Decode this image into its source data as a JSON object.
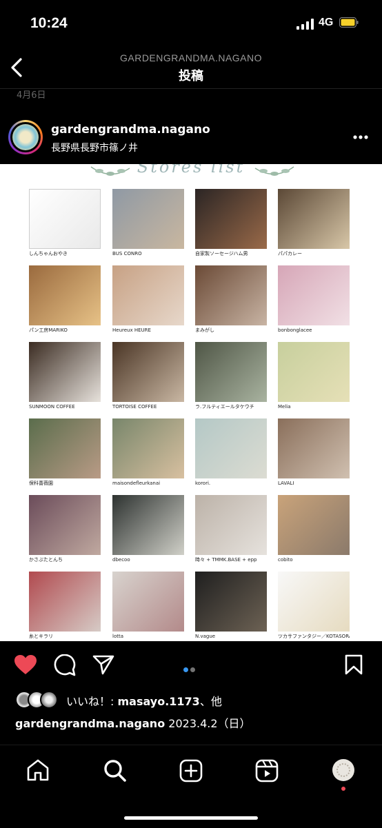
{
  "status_bar": {
    "time": "10:24",
    "network": "4G"
  },
  "nav": {
    "handle": "GARDENGRANDMA.NAGANO",
    "title": "投稿"
  },
  "post_date": "4月6日",
  "author": {
    "username": "gardengrandma.nagano",
    "location": "長野県長野市篠ノ井"
  },
  "post_image": {
    "header_title": "Stores list",
    "stores": [
      {
        "name": "しんちゃんおやき",
        "colors": [
          "#ffffff",
          "#e9e9e9"
        ]
      },
      {
        "name": "BUS CONRO",
        "colors": [
          "#8f99a4",
          "#c9b7a0"
        ]
      },
      {
        "name": "自家製ソーセージハム男",
        "colors": [
          "#2b2524",
          "#9a6a49"
        ]
      },
      {
        "name": "パパカレー",
        "colors": [
          "#5b4836",
          "#d8c7a8"
        ]
      },
      {
        "name": "パン工房MARIKO",
        "colors": [
          "#9a6a3e",
          "#e7c287"
        ]
      },
      {
        "name": "Heureux HEURE",
        "colors": [
          "#c7a184",
          "#e7d8cb"
        ]
      },
      {
        "name": "まみがし",
        "colors": [
          "#6b4a36",
          "#c8b4a4"
        ]
      },
      {
        "name": "bonbonglacee",
        "colors": [
          "#d6a6b7",
          "#f1e0e5"
        ]
      },
      {
        "name": "SUNMOON COFFEE",
        "colors": [
          "#3b2c22",
          "#e7e2dc"
        ]
      },
      {
        "name": "TORTOISE COFFEE",
        "colors": [
          "#4a3525",
          "#c9b7a3"
        ]
      },
      {
        "name": "ラ.フルティエールタケウチ",
        "colors": [
          "#4f5646",
          "#a9b3a0"
        ]
      },
      {
        "name": "Melia",
        "colors": [
          "#c7cf9d",
          "#e6e0b7"
        ]
      },
      {
        "name": "保科薔薇園",
        "colors": [
          "#5a6d4c",
          "#b99b86"
        ]
      },
      {
        "name": "maisondefleurkanai",
        "colors": [
          "#78866b",
          "#d8c0a0"
        ]
      },
      {
        "name": "korori.",
        "colors": [
          "#b4c8c6",
          "#dcdcd2"
        ]
      },
      {
        "name": "LAVALI",
        "colors": [
          "#8a6f5b",
          "#d0c0b0"
        ]
      },
      {
        "name": "かさぶたとんち",
        "colors": [
          "#6b4c5a",
          "#c0a9a0"
        ]
      },
      {
        "name": "dbecoo",
        "colors": [
          "#2d3230",
          "#d0d0c8"
        ]
      },
      {
        "name": "時々 + TMMK.BASE + epp",
        "colors": [
          "#bcb2a8",
          "#e6e2dd"
        ]
      },
      {
        "name": "cobito",
        "colors": [
          "#c9a37a",
          "#8b7a6b"
        ]
      },
      {
        "name": "糸とキラリ",
        "colors": [
          "#b14a4f",
          "#d6cbc6"
        ]
      },
      {
        "name": "lotta",
        "colors": [
          "#d8d3ce",
          "#b38a8a"
        ]
      },
      {
        "name": "N.vague",
        "colors": [
          "#1f1f1f",
          "#6d6254"
        ]
      },
      {
        "name": "ツカサファンタジー／KOTASORAWORKS",
        "colors": [
          "#f8f8f8",
          "#e6dbc0"
        ]
      }
    ]
  },
  "actions": {
    "carousel_count": 2,
    "carousel_active": 0
  },
  "likes": {
    "prefix": "いいね！: ",
    "user": "masayo.1173",
    "suffix": "、他"
  },
  "caption": {
    "username": "gardengrandma.nagano",
    "date": " 2023.4.2（日）"
  },
  "colors": {
    "like": "#ed4956",
    "active_dot": "#3897f0",
    "inactive_dot": "#737373",
    "notification": "#ed4956"
  },
  "icons": [
    "back-icon",
    "more-icon",
    "heart-icon",
    "comment-icon",
    "share-icon",
    "bookmark-icon",
    "home-icon",
    "search-icon",
    "create-icon",
    "reels-icon",
    "profile-icon"
  ]
}
